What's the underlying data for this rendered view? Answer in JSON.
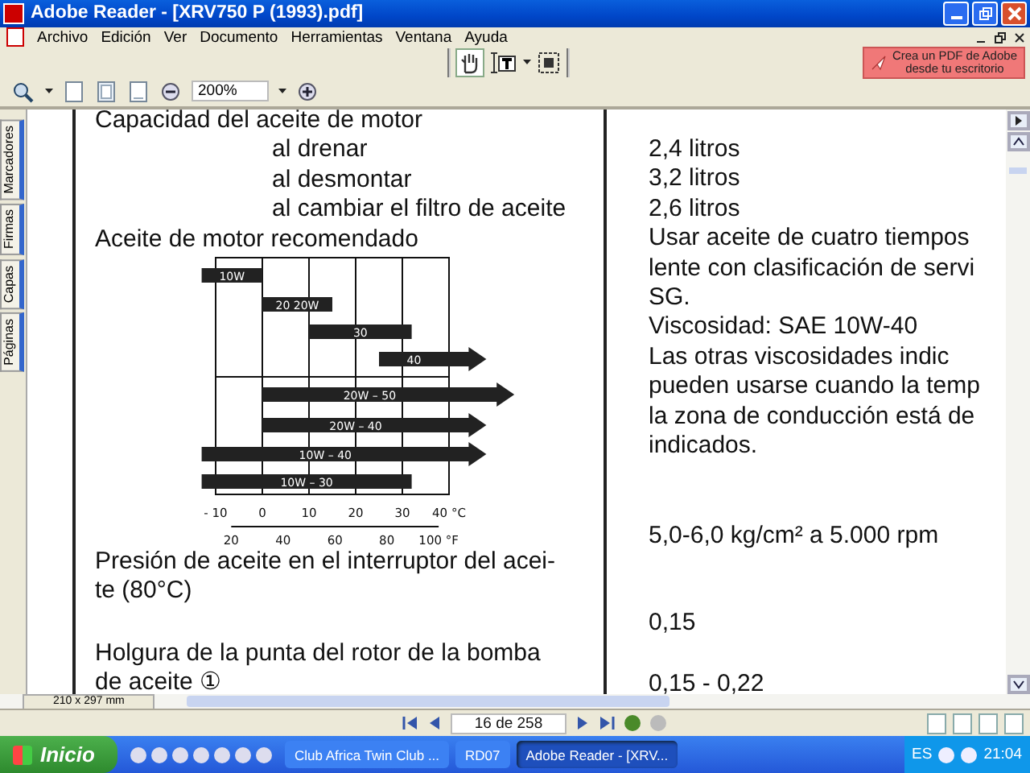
{
  "window": {
    "title": "Adobe Reader - [XRV750 P (1993).pdf]"
  },
  "menu": [
    "Archivo",
    "Edición",
    "Ver",
    "Documento",
    "Herramientas",
    "Ventana",
    "Ayuda"
  ],
  "tools": [
    {
      "kind": "hand",
      "selected": true
    },
    {
      "kind": "text-select",
      "selected": false
    },
    {
      "kind": "snapshot",
      "selected": false
    }
  ],
  "promo_button": {
    "lines": [
      "Crea un PDF de Adobe",
      "desde tu escritorio"
    ]
  },
  "zoom": {
    "value": "200%"
  },
  "side_tabs": [
    "Marcadores",
    "Firmas",
    "Capas",
    "Páginas"
  ],
  "page": {
    "left": [
      {
        "kind": "heading",
        "text": "Capacidad del aceite de motor"
      },
      {
        "kind": "indent",
        "text": "al drenar"
      },
      {
        "kind": "indent",
        "text": "al desmontar"
      },
      {
        "kind": "indent",
        "text": "al cambiar el filtro de aceite"
      },
      {
        "kind": "heading",
        "text": "Aceite de motor recomendado"
      },
      {
        "kind": "chart"
      },
      {
        "kind": "heading",
        "text": "Presión de aceite en el interruptor del acei-"
      },
      {
        "kind": "heading",
        "text": "te (80°C)"
      },
      {
        "kind": "gap"
      },
      {
        "kind": "heading",
        "text": "Holgura de la punta del rotor de la bomba"
      },
      {
        "kind": "heading",
        "text": "de aceite ①"
      }
    ],
    "right": [
      {
        "kind": "gap"
      },
      {
        "kind": "text",
        "text": "2,4 litros"
      },
      {
        "kind": "text",
        "text": "3,2 litros"
      },
      {
        "kind": "text",
        "text": "2,6 litros"
      },
      {
        "kind": "text",
        "text": "Usar aceite de cuatro tiempos"
      },
      {
        "kind": "text",
        "text": "lente con clasificación de servi"
      },
      {
        "kind": "text",
        "text": "SG."
      },
      {
        "kind": "text",
        "text": "Viscosidad: SAE 10W-40"
      },
      {
        "kind": "text",
        "text": "Las otras viscosidades indic"
      },
      {
        "kind": "text",
        "text": "pueden usarse cuando la temp"
      },
      {
        "kind": "text",
        "text": "la zona de conducción está de"
      },
      {
        "kind": "text",
        "text": "indicados."
      },
      {
        "kind": "gap"
      },
      {
        "kind": "text",
        "text": "5,0-6,0 kg/cm² a 5.000 rpm"
      },
      {
        "kind": "gap"
      },
      {
        "kind": "text",
        "text": "0,15"
      },
      {
        "kind": "gap"
      },
      {
        "kind": "text",
        "text": "0,15 - 0,22"
      }
    ],
    "viscosity_chart": {
      "grades": [
        {
          "label": "10W",
          "arrow": false
        },
        {
          "label": "20  20W",
          "arrow": false
        },
        {
          "label": "30",
          "arrow": false
        },
        {
          "label": "40",
          "arrow": true
        },
        {
          "label": "20W – 50",
          "arrow": true
        },
        {
          "label": "20W – 40",
          "arrow": true
        },
        {
          "label": "10W – 40",
          "arrow": true
        },
        {
          "label": "10W – 30",
          "arrow": false
        }
      ],
      "celsius_ticks": [
        "- 10",
        "0",
        "10",
        "20",
        "30",
        "40 °C"
      ],
      "fahrenheit_ticks": [
        "20",
        "40",
        "60",
        "80",
        "100 °F"
      ]
    }
  },
  "page_size": "210 x 297 mm",
  "page_nav": {
    "value": "16 de 258"
  },
  "taskbar": {
    "start": "Inicio",
    "tasks": [
      {
        "label": "Club Africa Twin Club ...",
        "selected": false
      },
      {
        "label": "RD07",
        "selected": false
      },
      {
        "label": "Adobe Reader - [XRV...",
        "selected": true
      }
    ],
    "language": "ES",
    "clock": "21:04"
  }
}
